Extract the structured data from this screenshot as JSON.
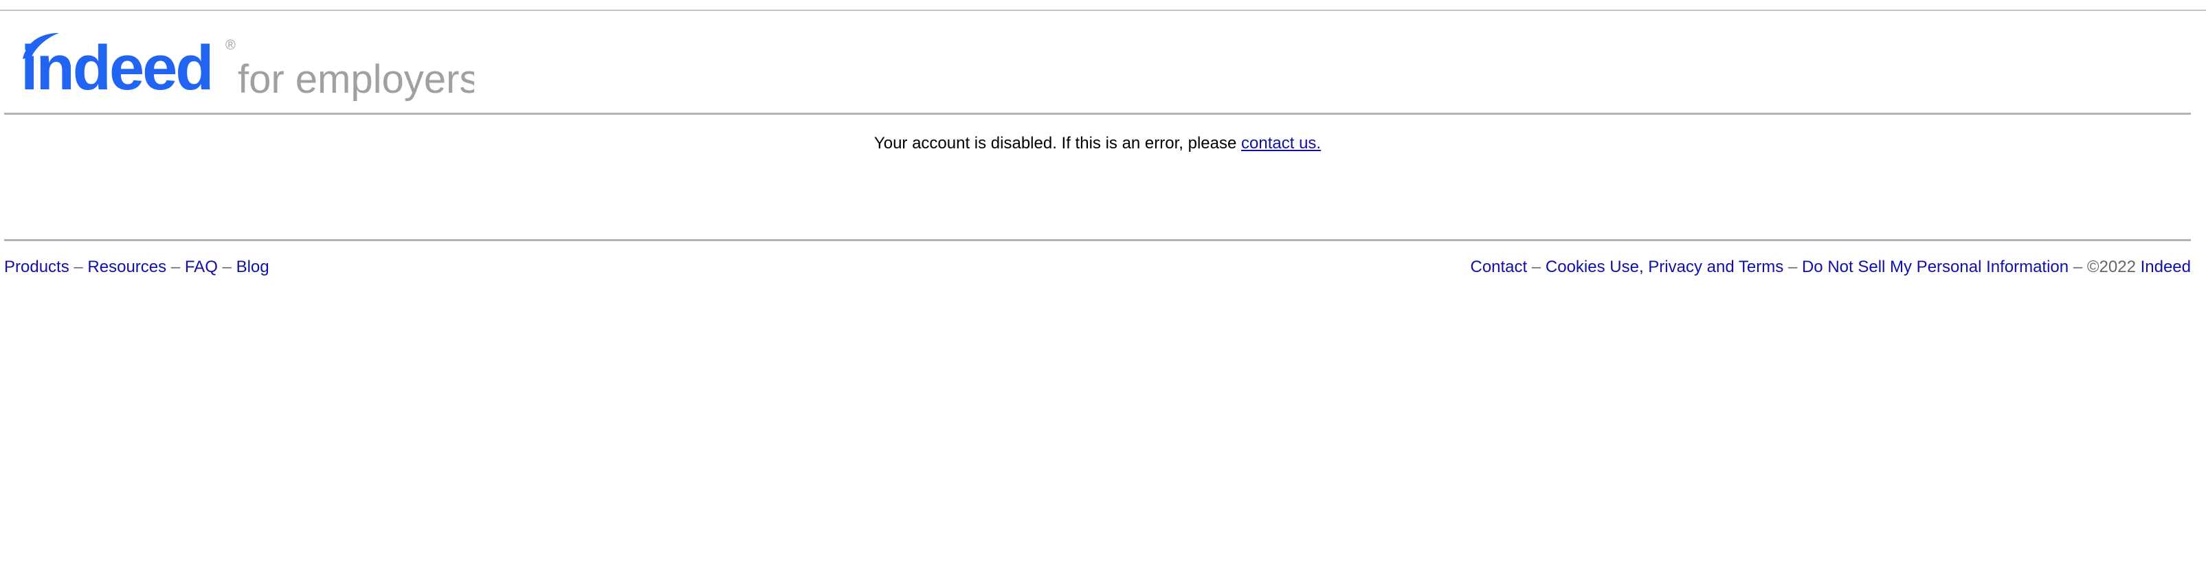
{
  "header": {
    "logo_word": "indeed",
    "logo_registered": "®",
    "logo_tagline": "for employers",
    "brand_color": "#2164f3",
    "tagline_color": "#a0a0a0"
  },
  "main": {
    "message_text": "Your account is disabled. If this is an error, please ",
    "contact_link": "contact us."
  },
  "footer": {
    "left_links": [
      "Products",
      "Resources",
      "FAQ",
      "Blog"
    ],
    "right_links": [
      "Contact",
      "Cookies Use, Privacy and Terms",
      "Do Not Sell My Personal Information"
    ],
    "separator": "–",
    "copyright": "©2022",
    "brand_link": "Indeed"
  },
  "colors": {
    "link": "#1010a8",
    "rule": "#b3b3b3",
    "muted": "#666666"
  }
}
